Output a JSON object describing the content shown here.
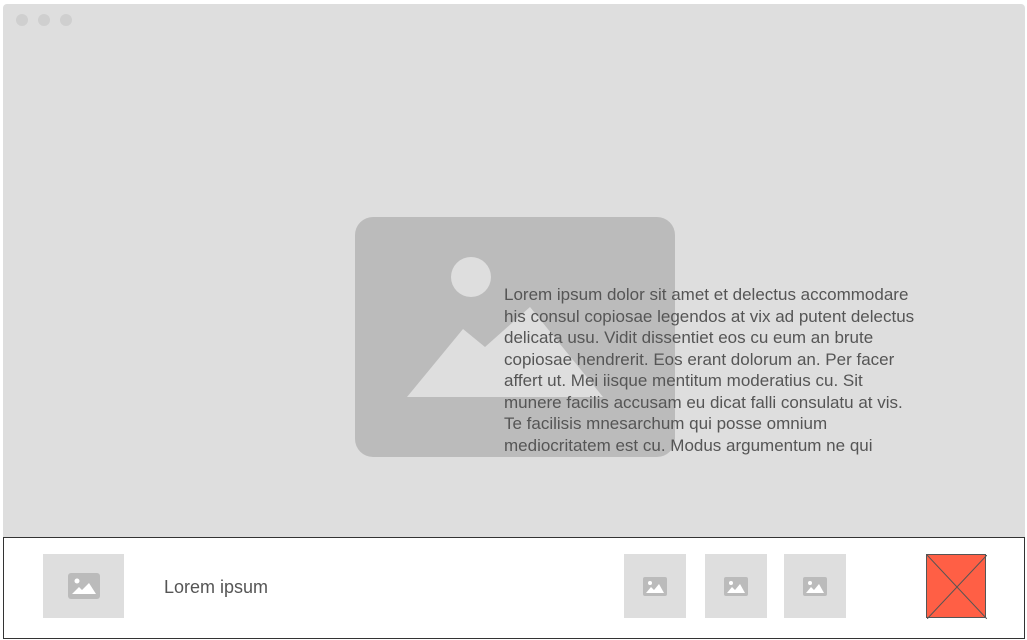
{
  "hero": {
    "text": "Lorem ipsum dolor sit amet et delectus accommodare his consul copiosae legendos at vix ad putent delectus delicata usu. Vidit dissentiet eos cu eum an brute copiosae hendrerit. Eos erant dolorum an. Per facer affert ut. Mei iisque mentitum moderatius cu. Sit munere facilis accusam eu dicat falli consulatu at vis. Te facilisis mnesarchum qui posse omnium mediocritatem est cu. Modus argumentum ne qui"
  },
  "bottom_bar": {
    "label": "Lorem ipsum"
  },
  "colors": {
    "background": "#dedede",
    "placeholder": "#bbbbbb",
    "close": "#ff5f45"
  },
  "icons": [
    "image-placeholder-icon",
    "close-x-icon"
  ]
}
